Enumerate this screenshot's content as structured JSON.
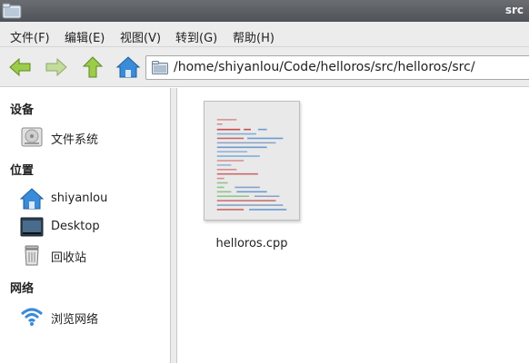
{
  "window": {
    "title": "src"
  },
  "menu": [
    {
      "label": "文件(F)"
    },
    {
      "label": "编辑(E)"
    },
    {
      "label": "视图(V)"
    },
    {
      "label": "转到(G)"
    },
    {
      "label": "帮助(H)"
    }
  ],
  "location": {
    "path": "/home/shiyanlou/Code/helloros/src/helloros/src/"
  },
  "sidebar": {
    "devices_header": "设备",
    "filesystem_label": "文件系统",
    "places_header": "位置",
    "home_label": "shiyanlou",
    "desktop_label": "Desktop",
    "trash_label": "回收站",
    "network_header": "网络",
    "browse_network_label": "浏览网络"
  },
  "files": [
    {
      "name": "helloros.cpp"
    }
  ],
  "colors": {
    "arrow_green": "#8bc34a",
    "home_blue": "#3a8bd8",
    "titlebar": "#585c60"
  }
}
